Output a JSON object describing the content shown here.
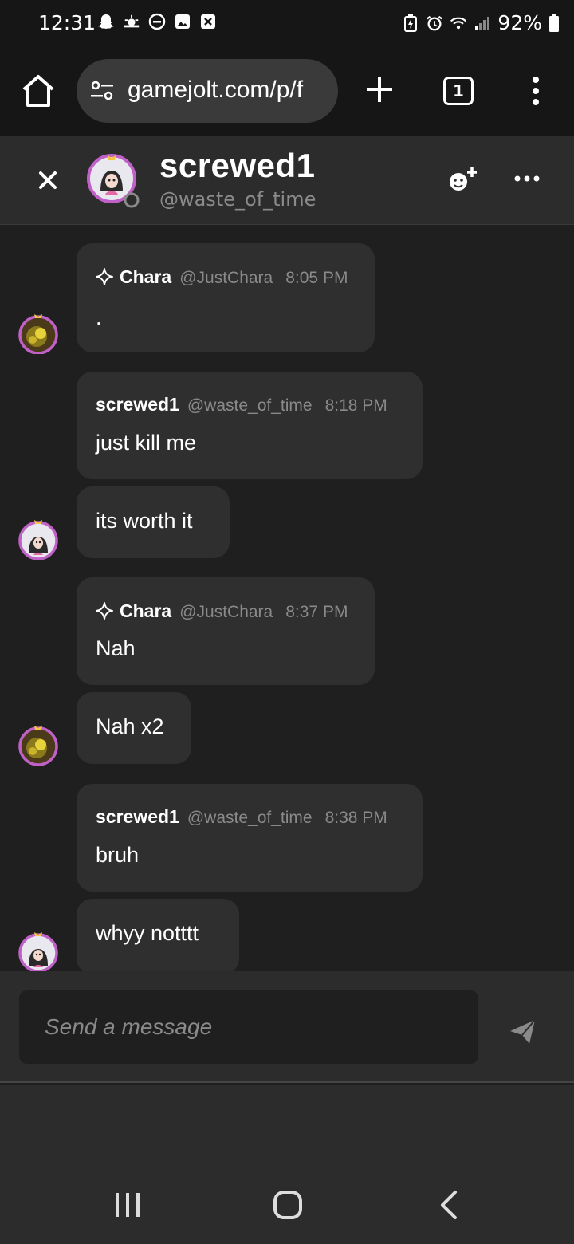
{
  "status_bar": {
    "time": "12:31",
    "battery": "92%"
  },
  "browser": {
    "url": "gamejolt.com/p/f",
    "tab_count": "1"
  },
  "chat_header": {
    "display_name": "screwed1",
    "handle": "@waste_of_time"
  },
  "messages": [
    {
      "name": "Chara",
      "handle": "@JustChara",
      "time": "8:05 PM",
      "lines": [
        "."
      ],
      "verified": true
    },
    {
      "name": "screwed1",
      "handle": "@waste_of_time",
      "time": "8:18 PM",
      "lines": [
        "just kill me",
        "its worth it"
      ],
      "verified": false
    },
    {
      "name": "Chara",
      "handle": "@JustChara",
      "time": "8:37 PM",
      "lines": [
        "Nah",
        "Nah x2"
      ],
      "verified": true
    },
    {
      "name": "screwed1",
      "handle": "@waste_of_time",
      "time": "8:38 PM",
      "lines": [
        "bruh",
        "whyy notttt"
      ],
      "verified": false
    }
  ],
  "composer": {
    "placeholder": "Send a message"
  },
  "colors": {
    "background": "#1f1f1f",
    "bubble": "#2f2f2f",
    "header": "#2c2c2c",
    "muted_text": "#8a8a8a",
    "avatar_ring": "#c061c8"
  },
  "icons": [
    "home-icon",
    "tune-icon",
    "plus-icon",
    "tab-switcher-icon",
    "more-vert-icon",
    "close-icon",
    "add-friend-icon",
    "more-horiz-icon",
    "sparkle-icon",
    "send-icon",
    "nav-recents-icon",
    "nav-home-icon",
    "nav-back-icon"
  ]
}
